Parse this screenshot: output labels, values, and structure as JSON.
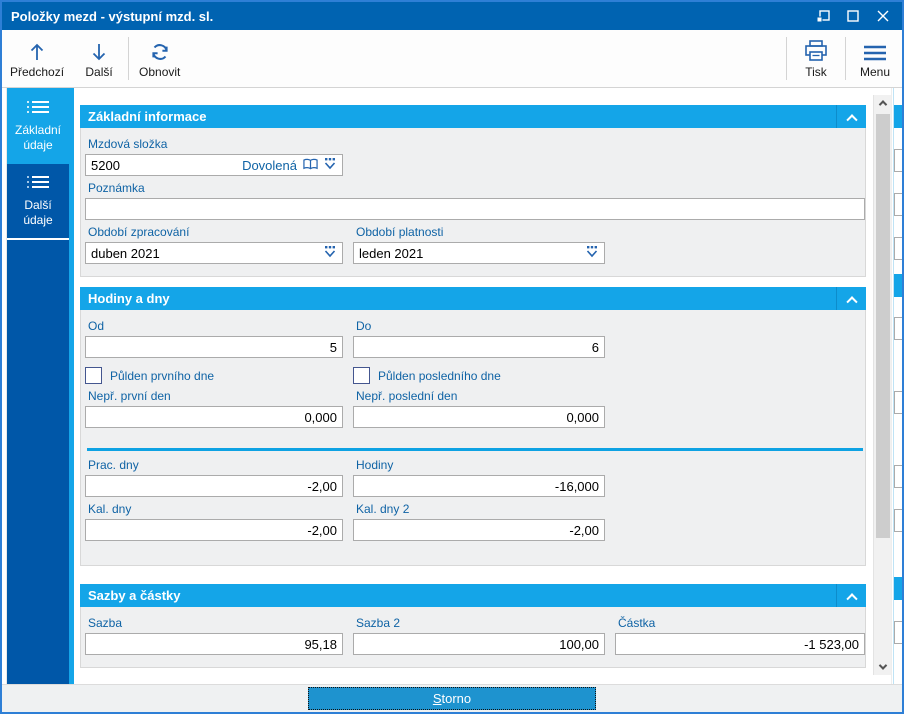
{
  "window": {
    "title": "Položky mezd - výstupní mzd. sl."
  },
  "toolbar": {
    "prev_label": "Předchozí",
    "next_label": "Další",
    "refresh_label": "Obnovit",
    "print_label": "Tisk",
    "menu_label": "Menu"
  },
  "sidebar": {
    "items": [
      {
        "label": "Základní\núdaje",
        "active": true
      },
      {
        "label": "Další\núdaje",
        "active": false
      }
    ]
  },
  "sections": {
    "basic": {
      "title": "Základní informace",
      "wage_component": {
        "label": "Mzdová složka",
        "value": "5200",
        "display": "Dovolená"
      },
      "note": {
        "label": "Poznámka",
        "value": ""
      },
      "period_processing": {
        "label": "Období zpracování",
        "value": "duben 2021"
      },
      "period_validity": {
        "label": "Období platnosti",
        "value": "leden 2021"
      }
    },
    "hours_days": {
      "title": "Hodiny a dny",
      "from": {
        "label": "Od",
        "value": "5"
      },
      "to": {
        "label": "Do",
        "value": "6"
      },
      "halfday_first": {
        "label": "Půlden prvního dne",
        "checked": false
      },
      "halfday_last": {
        "label": "Půlden posledního dne",
        "checked": false
      },
      "excl_first_day": {
        "label": "Nepř. první den",
        "value": "0,000"
      },
      "excl_last_day": {
        "label": "Nepř. poslední den",
        "value": "0,000"
      },
      "work_days": {
        "label": "Prac. dny",
        "value": "-2,00"
      },
      "hours": {
        "label": "Hodiny",
        "value": "-16,000"
      },
      "cal_days": {
        "label": "Kal. dny",
        "value": "-2,00"
      },
      "cal_days_2": {
        "label": "Kal. dny 2",
        "value": "-2,00"
      }
    },
    "rates_amounts": {
      "title": "Sazby a částky",
      "rate": {
        "label": "Sazba",
        "value": "95,18"
      },
      "rate_2": {
        "label": "Sazba 2",
        "value": "100,00"
      },
      "amount": {
        "label": "Částka",
        "value": "-1 523,00"
      }
    }
  },
  "footer": {
    "cancel_label": "Storno"
  },
  "colors": {
    "accent": "#14a5e8",
    "titlebar": "#0063b1",
    "sidebar": "#0057a8",
    "label_blue": "#0f63a5",
    "icon_blue": "#2564af",
    "storno_bg": "#1e93cf"
  }
}
